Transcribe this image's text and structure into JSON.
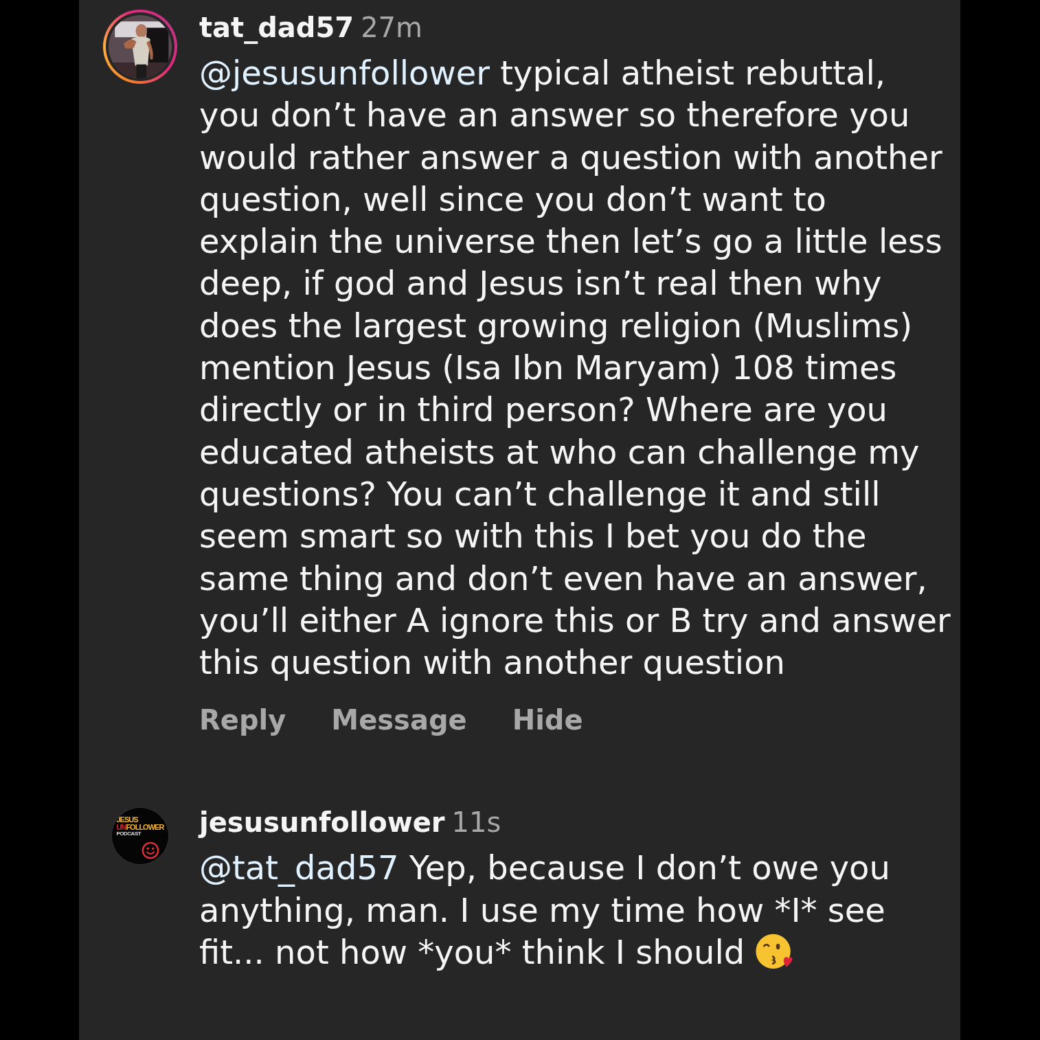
{
  "comments": [
    {
      "username": "tat_dad57",
      "time": "27m",
      "avatar": {
        "kind": "picture",
        "story_ring": true
      },
      "mention": "@jesusunfollower",
      "text": "typical atheist rebuttal, you don’t have an answer so therefore you would rather answer a question with another question, well since you don’t want to explain the universe then let’s go a little less deep, if god and Jesus isn’t real then why does the largest growing religion (Muslims) mention Jesus (Isa Ibn Maryam) 108 times directly or in third person? Where are you educated atheists at who can challenge my questions? You can’t challenge it and still seem smart so with this I bet you do the same thing and don’t even have an answer, you’ll either A ignore this or B try and answer this question with another question",
      "actions": [
        "Reply",
        "Message",
        "Hide"
      ]
    },
    {
      "username": "jesusunfollower",
      "time": "11s",
      "avatar": {
        "kind": "logo",
        "logo": {
          "line1": "JESUS",
          "line2_red": "UN",
          "line2_yellow": "FOLLOWER",
          "line3": "PODCAST"
        }
      },
      "mention": "@tat_dad57",
      "text": "Yep, because I don’t owe you anything, man. I use my time how *I* see fit... not how *you* think I should",
      "emoji": true
    }
  ]
}
